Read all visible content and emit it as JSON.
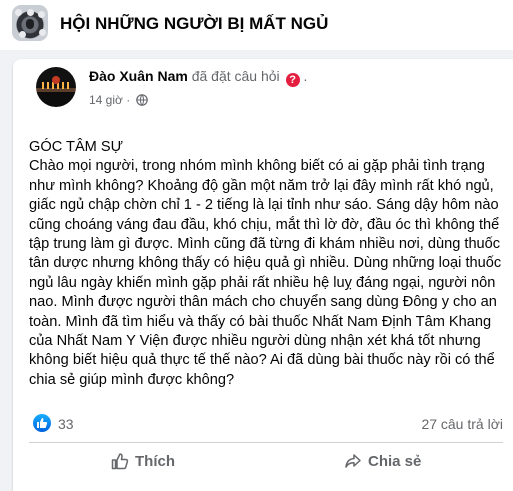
{
  "group": {
    "name": "HỘI NHỮNG NGƯỜI BỊ MẤT NGỦ"
  },
  "post": {
    "author": "Đào Xuân Nam",
    "action": "đã đặt câu hỏi",
    "question_icon": "?",
    "trailing": ".",
    "time": "14 giờ",
    "privacy_icon": "globe-icon",
    "heading": "GÓC TÂM SỰ",
    "body": "Chào mọi người, trong nhóm mình không biết có ai gặp phải tình trạng như mình không? Khoảng độ gần một năm trở lại đây mình rất khó ngủ, giấc ngủ chập chờn chỉ 1 - 2 tiếng là lại tỉnh như sáo. Sáng dậy hôm nào cũng choáng váng đau đầu, khó chịu, mắt thì lờ đờ, đầu óc thì không thể tập trung làm gì được. Mình cũng đã từng đi khám nhiều nơi, dùng thuốc tân dược nhưng không thấy có hiệu quả gì nhiều. Dùng những loại thuốc ngủ lâu ngày khiến mình gặp phải rất nhiều hệ luỵ đáng ngại, người nôn nao. Mình được người thân mách cho chuyển sang dùng Đông y cho an toàn. Mình đã tìm hiểu và thấy có bài thuốc Nhất Nam Định Tâm Khang của Nhất Nam Y Viện được nhiều người dùng nhận xét khá tốt nhưng không biết hiệu quả thực tế thế nào? Ai đã dùng bài thuốc này rồi có thể chia sẻ giúp mình được không?",
    "reactions": "33",
    "answers": "27 câu trả lời"
  },
  "actions": {
    "like": "Thích",
    "share": "Chia sẻ"
  },
  "colors": {
    "like_blue": "#1877f2",
    "question_red": "#e41e3f",
    "muted": "#65676b"
  }
}
